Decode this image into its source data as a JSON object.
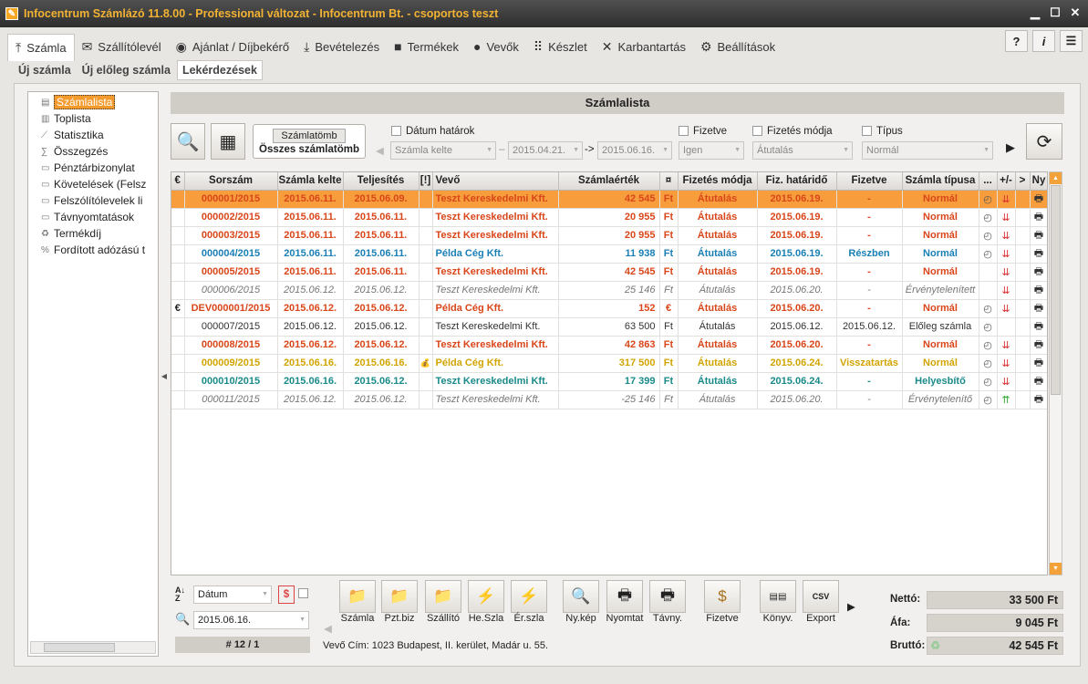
{
  "window": {
    "title": "Infocentrum Számlázó 11.8.00 - Professional változat - Infocentrum Bt. - csoportos teszt"
  },
  "menu": [
    "Számla",
    "Szállítólevél",
    "Ajánlat / Díjbekérő",
    "Bevételezés",
    "Termékek",
    "Vevők",
    "Készlet",
    "Karbantartás",
    "Beállítások"
  ],
  "subtabs": [
    "Új számla",
    "Új előleg számla",
    "Lekérdezések"
  ],
  "tree": [
    "Számlalista",
    "Toplista",
    "Statisztika",
    "Összegzés",
    "Pénztárbizonylat",
    "Követelések (Felsz",
    "Felszólítólevelek li",
    "Távnyomtatások",
    "Termékdíj",
    "Fordított adózású t"
  ],
  "header": {
    "title": "Számlalista"
  },
  "filters": {
    "szamlatomb_btn": "Számlatömb",
    "szamlatomb_val": "Összes számlatömb",
    "datum_label": "Dátum határok",
    "datum_type": "Számla kelte",
    "date_from": "2015.04.21.",
    "arrow": "->",
    "date_to": "2015.06.16.",
    "fizetve_label": "Fizetve",
    "fizetve_val": "Igen",
    "fizmod_label": "Fizetés módja",
    "fizmod_val": "Átutalás",
    "tipus_label": "Típus",
    "tipus_val": "Normál"
  },
  "columns": [
    "€",
    "Sorszám",
    "Számla kelte",
    "Teljesítés",
    "[!]",
    "Vevő",
    "Számlaérték",
    "¤",
    "Fizetés módja",
    "Fiz. határidő",
    "Fizetve",
    "Számla típusa",
    "...",
    "+/-",
    ">",
    "Ny"
  ],
  "rows": [
    {
      "cur": "",
      "no": "000001/2015",
      "kelte": "2015.06.11.",
      "telj": "2015.06.09.",
      "vevo": "Teszt Kereskedelmi Kft.",
      "ertek": "42 545",
      "pe": "Ft",
      "mod": "Átutalás",
      "hat": "2015.06.19.",
      "fiz": "-",
      "tipus": "Normál",
      "style": "bold sel",
      "color": "c-red"
    },
    {
      "cur": "",
      "no": "000002/2015",
      "kelte": "2015.06.11.",
      "telj": "2015.06.11.",
      "vevo": "Teszt Kereskedelmi Kft.",
      "ertek": "20 955",
      "pe": "Ft",
      "mod": "Átutalás",
      "hat": "2015.06.19.",
      "fiz": "-",
      "tipus": "Normál",
      "style": "bold",
      "color": "c-red"
    },
    {
      "cur": "",
      "no": "000003/2015",
      "kelte": "2015.06.11.",
      "telj": "2015.06.11.",
      "vevo": "Teszt Kereskedelmi Kft.",
      "ertek": "20 955",
      "pe": "Ft",
      "mod": "Átutalás",
      "hat": "2015.06.19.",
      "fiz": "-",
      "tipus": "Normál",
      "style": "bold",
      "color": "c-red"
    },
    {
      "cur": "",
      "no": "000004/2015",
      "kelte": "2015.06.11.",
      "telj": "2015.06.11.",
      "vevo": "Példa Cég Kft.",
      "ertek": "11 938",
      "pe": "Ft",
      "mod": "Átutalás",
      "hat": "2015.06.19.",
      "fiz": "Részben",
      "tipus": "Normál",
      "style": "bold",
      "color": "c-blue"
    },
    {
      "cur": "",
      "no": "000005/2015",
      "kelte": "2015.06.11.",
      "telj": "2015.06.11.",
      "vevo": "Teszt Kereskedelmi Kft.",
      "ertek": "42 545",
      "pe": "Ft",
      "mod": "Átutalás",
      "hat": "2015.06.19.",
      "fiz": "-",
      "tipus": "Normál",
      "style": "bold",
      "color": "c-red"
    },
    {
      "cur": "",
      "no": "000006/2015",
      "kelte": "2015.06.12.",
      "telj": "2015.06.12.",
      "vevo": "Teszt Kereskedelmi Kft.",
      "ertek": "25 146",
      "pe": "Ft",
      "mod": "Átutalás",
      "hat": "2015.06.20.",
      "fiz": "-",
      "tipus": "Érvénytelenített",
      "style": "italic",
      "color": "c-gray"
    },
    {
      "cur": "€",
      "no": "DEV000001/2015",
      "kelte": "2015.06.12.",
      "telj": "2015.06.12.",
      "vevo": "Példa Cég Kft.",
      "ertek": "152",
      "pe": "€",
      "mod": "Átutalás",
      "hat": "2015.06.20.",
      "fiz": "-",
      "tipus": "Normál",
      "style": "bold",
      "color": "c-red"
    },
    {
      "cur": "",
      "no": "000007/2015",
      "kelte": "2015.06.12.",
      "telj": "2015.06.12.",
      "vevo": "Teszt Kereskedelmi Kft.",
      "ertek": "63 500",
      "pe": "Ft",
      "mod": "Átutalás",
      "hat": "2015.06.12.",
      "fiz": "2015.06.12.",
      "tipus": "Előleg számla",
      "style": "",
      "color": "c-black"
    },
    {
      "cur": "",
      "no": "000008/2015",
      "kelte": "2015.06.12.",
      "telj": "2015.06.12.",
      "vevo": "Teszt Kereskedelmi Kft.",
      "ertek": "42 863",
      "pe": "Ft",
      "mod": "Átutalás",
      "hat": "2015.06.20.",
      "fiz": "-",
      "tipus": "Normál",
      "style": "bold",
      "color": "c-red"
    },
    {
      "cur": "",
      "no": "000009/2015",
      "kelte": "2015.06.16.",
      "telj": "2015.06.16.",
      "vevo": "Példa Cég Kft.",
      "ertek": "317 500",
      "pe": "Ft",
      "mod": "Átutalás",
      "hat": "2015.06.24.",
      "fiz": "Visszatartás",
      "tipus": "Normál",
      "style": "bold",
      "color": "c-gold"
    },
    {
      "cur": "",
      "no": "000010/2015",
      "kelte": "2015.06.16.",
      "telj": "2015.06.12.",
      "vevo": "Teszt Kereskedelmi Kft.",
      "ertek": "17 399",
      "pe": "Ft",
      "mod": "Átutalás",
      "hat": "2015.06.24.",
      "fiz": "-",
      "tipus": "Helyesbítő",
      "style": "bold",
      "color": "c-teal"
    },
    {
      "cur": "",
      "no": "000011/2015",
      "kelte": "2015.06.12.",
      "telj": "2015.06.12.",
      "vevo": "Teszt Kereskedelmi Kft.",
      "ertek": "-25 146",
      "pe": "Ft",
      "mod": "Átutalás",
      "hat": "2015.06.20.",
      "fiz": "-",
      "tipus": "Érvénytelenítő",
      "style": "italic",
      "color": "c-gray"
    }
  ],
  "bottom": {
    "sort_field": "Dátum",
    "search_date": "2015.06.16.",
    "record": "# 12 / 1",
    "address": "Vevő Cím: 1023 Budapest, II. kerület, Madár u. 55.",
    "buttons": [
      "Számla",
      "Pzt.biz",
      "Szállító",
      "He.Szla",
      "Ér.szla",
      "Ny.kép",
      "Nyomtat",
      "Távny.",
      "Fizetve",
      "Könyv.",
      "Export"
    ],
    "netto_label": "Nettó:",
    "netto": "33 500 Ft",
    "afa_label": "Áfa:",
    "afa": "9 045 Ft",
    "brutto_label": "Bruttó:",
    "brutto": "42 545 Ft"
  }
}
